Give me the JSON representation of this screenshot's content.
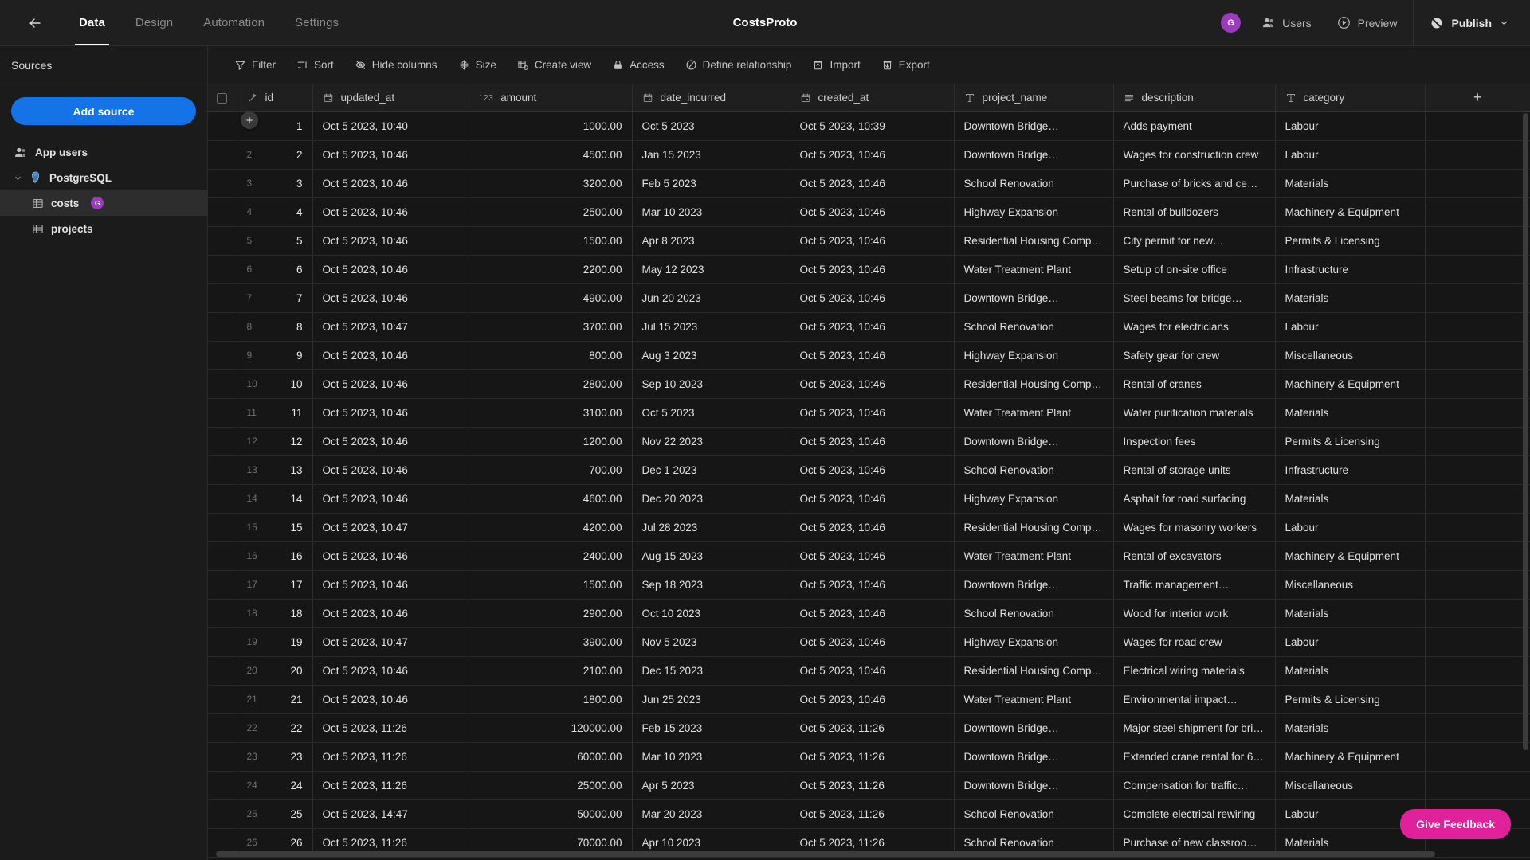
{
  "header": {
    "back_icon": "arrow-left-icon",
    "title": "CostsProto",
    "tabs": [
      {
        "label": "Data",
        "active": true
      },
      {
        "label": "Design",
        "active": false
      },
      {
        "label": "Automation",
        "active": false
      },
      {
        "label": "Settings",
        "active": false
      }
    ],
    "avatar_initial": "G",
    "users_label": "Users",
    "preview_label": "Preview",
    "publish_label": "Publish"
  },
  "sidebar": {
    "title": "Sources",
    "add_source_label": "Add source",
    "items": [
      {
        "label": "App users",
        "icon": "users-icon",
        "level": 0,
        "selected": false
      },
      {
        "label": "PostgreSQL",
        "icon": "postgresql-icon",
        "level": 1,
        "selected": false,
        "expanded": true
      },
      {
        "label": "costs",
        "icon": "table-icon",
        "level": 2,
        "selected": true,
        "badge": "G"
      },
      {
        "label": "projects",
        "icon": "table-icon",
        "level": 2,
        "selected": false
      }
    ]
  },
  "toolbar": {
    "items": [
      {
        "label": "Filter",
        "icon": "filter-icon"
      },
      {
        "label": "Sort",
        "icon": "sort-icon"
      },
      {
        "label": "Hide columns",
        "icon": "eye-off-icon"
      },
      {
        "label": "Size",
        "icon": "size-icon"
      },
      {
        "label": "Create view",
        "icon": "create-view-icon"
      },
      {
        "label": "Access",
        "icon": "lock-icon"
      },
      {
        "label": "Define relationship",
        "icon": "relationship-icon"
      },
      {
        "label": "Import",
        "icon": "import-icon"
      },
      {
        "label": "Export",
        "icon": "export-icon"
      }
    ]
  },
  "grid": {
    "add_column_label": "+",
    "add_row_label": "+",
    "columns": [
      {
        "name": "id",
        "type_icon": "magic-id-icon"
      },
      {
        "name": "updated_at",
        "type_icon": "calendar-icon"
      },
      {
        "name": "amount",
        "type_icon": "number-123-icon"
      },
      {
        "name": "date_incurred",
        "type_icon": "calendar-icon"
      },
      {
        "name": "created_at",
        "type_icon": "calendar-icon"
      },
      {
        "name": "project_name",
        "type_icon": "text-icon"
      },
      {
        "name": "description",
        "type_icon": "longtext-icon"
      },
      {
        "name": "category",
        "type_icon": "text-icon"
      }
    ],
    "rows": [
      {
        "n": "1",
        "id": "1",
        "updated_at": "Oct 5 2023, 10:40",
        "amount": "1000.00",
        "date_incurred": "Oct 5 2023",
        "created_at": "Oct 5 2023, 10:39",
        "project_name": "Downtown Bridge…",
        "description": "Adds payment",
        "category": "Labour"
      },
      {
        "n": "2",
        "id": "2",
        "updated_at": "Oct 5 2023, 10:46",
        "amount": "4500.00",
        "date_incurred": "Jan 15 2023",
        "created_at": "Oct 5 2023, 10:46",
        "project_name": "Downtown Bridge…",
        "description": "Wages for construction crew",
        "category": "Labour"
      },
      {
        "n": "3",
        "id": "3",
        "updated_at": "Oct 5 2023, 10:46",
        "amount": "3200.00",
        "date_incurred": "Feb 5 2023",
        "created_at": "Oct 5 2023, 10:46",
        "project_name": "School Renovation",
        "description": "Purchase of bricks and cement",
        "category": "Materials"
      },
      {
        "n": "4",
        "id": "4",
        "updated_at": "Oct 5 2023, 10:46",
        "amount": "2500.00",
        "date_incurred": "Mar 10 2023",
        "created_at": "Oct 5 2023, 10:46",
        "project_name": "Highway Expansion",
        "description": "Rental of bulldozers",
        "category": "Machinery & Equipment"
      },
      {
        "n": "5",
        "id": "5",
        "updated_at": "Oct 5 2023, 10:46",
        "amount": "1500.00",
        "date_incurred": "Apr 8 2023",
        "created_at": "Oct 5 2023, 10:46",
        "project_name": "Residential Housing Complex",
        "description": "City permit for new…",
        "category": "Permits & Licensing"
      },
      {
        "n": "6",
        "id": "6",
        "updated_at": "Oct 5 2023, 10:46",
        "amount": "2200.00",
        "date_incurred": "May 12 2023",
        "created_at": "Oct 5 2023, 10:46",
        "project_name": "Water Treatment Plant",
        "description": "Setup of on-site office",
        "category": "Infrastructure"
      },
      {
        "n": "7",
        "id": "7",
        "updated_at": "Oct 5 2023, 10:46",
        "amount": "4900.00",
        "date_incurred": "Jun 20 2023",
        "created_at": "Oct 5 2023, 10:46",
        "project_name": "Downtown Bridge…",
        "description": "Steel beams for bridge…",
        "category": "Materials"
      },
      {
        "n": "8",
        "id": "8",
        "updated_at": "Oct 5 2023, 10:47",
        "amount": "3700.00",
        "date_incurred": "Jul 15 2023",
        "created_at": "Oct 5 2023, 10:46",
        "project_name": "School Renovation",
        "description": "Wages for electricians",
        "category": "Labour"
      },
      {
        "n": "9",
        "id": "9",
        "updated_at": "Oct 5 2023, 10:46",
        "amount": "800.00",
        "date_incurred": "Aug 3 2023",
        "created_at": "Oct 5 2023, 10:46",
        "project_name": "Highway Expansion",
        "description": "Safety gear for crew",
        "category": "Miscellaneous"
      },
      {
        "n": "10",
        "id": "10",
        "updated_at": "Oct 5 2023, 10:46",
        "amount": "2800.00",
        "date_incurred": "Sep 10 2023",
        "created_at": "Oct 5 2023, 10:46",
        "project_name": "Residential Housing Complex",
        "description": "Rental of cranes",
        "category": "Machinery & Equipment"
      },
      {
        "n": "11",
        "id": "11",
        "updated_at": "Oct 5 2023, 10:46",
        "amount": "3100.00",
        "date_incurred": "Oct 5 2023",
        "created_at": "Oct 5 2023, 10:46",
        "project_name": "Water Treatment Plant",
        "description": "Water purification materials",
        "category": "Materials"
      },
      {
        "n": "12",
        "id": "12",
        "updated_at": "Oct 5 2023, 10:46",
        "amount": "1200.00",
        "date_incurred": "Nov 22 2023",
        "created_at": "Oct 5 2023, 10:46",
        "project_name": "Downtown Bridge…",
        "description": "Inspection fees",
        "category": "Permits & Licensing"
      },
      {
        "n": "13",
        "id": "13",
        "updated_at": "Oct 5 2023, 10:46",
        "amount": "700.00",
        "date_incurred": "Dec 1 2023",
        "created_at": "Oct 5 2023, 10:46",
        "project_name": "School Renovation",
        "description": "Rental of storage units",
        "category": "Infrastructure"
      },
      {
        "n": "14",
        "id": "14",
        "updated_at": "Oct 5 2023, 10:46",
        "amount": "4600.00",
        "date_incurred": "Dec 20 2023",
        "created_at": "Oct 5 2023, 10:46",
        "project_name": "Highway Expansion",
        "description": "Asphalt for road surfacing",
        "category": "Materials"
      },
      {
        "n": "15",
        "id": "15",
        "updated_at": "Oct 5 2023, 10:47",
        "amount": "4200.00",
        "date_incurred": "Jul 28 2023",
        "created_at": "Oct 5 2023, 10:46",
        "project_name": "Residential Housing Complex",
        "description": "Wages for masonry workers",
        "category": "Labour"
      },
      {
        "n": "16",
        "id": "16",
        "updated_at": "Oct 5 2023, 10:46",
        "amount": "2400.00",
        "date_incurred": "Aug 15 2023",
        "created_at": "Oct 5 2023, 10:46",
        "project_name": "Water Treatment Plant",
        "description": "Rental of excavators",
        "category": "Machinery & Equipment"
      },
      {
        "n": "17",
        "id": "17",
        "updated_at": "Oct 5 2023, 10:46",
        "amount": "1500.00",
        "date_incurred": "Sep 18 2023",
        "created_at": "Oct 5 2023, 10:46",
        "project_name": "Downtown Bridge…",
        "description": "Traffic management…",
        "category": "Miscellaneous"
      },
      {
        "n": "18",
        "id": "18",
        "updated_at": "Oct 5 2023, 10:46",
        "amount": "2900.00",
        "date_incurred": "Oct 10 2023",
        "created_at": "Oct 5 2023, 10:46",
        "project_name": "School Renovation",
        "description": "Wood for interior work",
        "category": "Materials"
      },
      {
        "n": "19",
        "id": "19",
        "updated_at": "Oct 5 2023, 10:47",
        "amount": "3900.00",
        "date_incurred": "Nov 5 2023",
        "created_at": "Oct 5 2023, 10:46",
        "project_name": "Highway Expansion",
        "description": "Wages for road crew",
        "category": "Labour"
      },
      {
        "n": "20",
        "id": "20",
        "updated_at": "Oct 5 2023, 10:46",
        "amount": "2100.00",
        "date_incurred": "Dec 15 2023",
        "created_at": "Oct 5 2023, 10:46",
        "project_name": "Residential Housing Complex",
        "description": "Electrical wiring materials",
        "category": "Materials"
      },
      {
        "n": "21",
        "id": "21",
        "updated_at": "Oct 5 2023, 10:46",
        "amount": "1800.00",
        "date_incurred": "Jun 25 2023",
        "created_at": "Oct 5 2023, 10:46",
        "project_name": "Water Treatment Plant",
        "description": "Environmental impact…",
        "category": "Permits & Licensing"
      },
      {
        "n": "22",
        "id": "22",
        "updated_at": "Oct 5 2023, 11:26",
        "amount": "120000.00",
        "date_incurred": "Feb 15 2023",
        "created_at": "Oct 5 2023, 11:26",
        "project_name": "Downtown Bridge…",
        "description": "Major steel shipment for brid…",
        "category": "Materials"
      },
      {
        "n": "23",
        "id": "23",
        "updated_at": "Oct 5 2023, 11:26",
        "amount": "60000.00",
        "date_incurred": "Mar 10 2023",
        "created_at": "Oct 5 2023, 11:26",
        "project_name": "Downtown Bridge…",
        "description": "Extended crane rental for 6…",
        "category": "Machinery & Equipment"
      },
      {
        "n": "24",
        "id": "24",
        "updated_at": "Oct 5 2023, 11:26",
        "amount": "25000.00",
        "date_incurred": "Apr 5 2023",
        "created_at": "Oct 5 2023, 11:26",
        "project_name": "Downtown Bridge…",
        "description": "Compensation for traffic…",
        "category": "Miscellaneous"
      },
      {
        "n": "25",
        "id": "25",
        "updated_at": "Oct 5 2023, 14:47",
        "amount": "50000.00",
        "date_incurred": "Mar 20 2023",
        "created_at": "Oct 5 2023, 11:26",
        "project_name": "School Renovation",
        "description": "Complete electrical rewiring",
        "category": "Labour"
      },
      {
        "n": "26",
        "id": "26",
        "updated_at": "Oct 5 2023, 11:26",
        "amount": "70000.00",
        "date_incurred": "Apr 10 2023",
        "created_at": "Oct 5 2023, 11:26",
        "project_name": "School Renovation",
        "description": "Purchase of new classroom…",
        "category": "Materials"
      }
    ]
  },
  "feedback": {
    "label": "Give Feedback"
  },
  "colors": {
    "accent_blue": "#1473e6",
    "accent_purple": "#9c3ac0",
    "accent_pink": "#e0219b",
    "bg": "#161616"
  }
}
